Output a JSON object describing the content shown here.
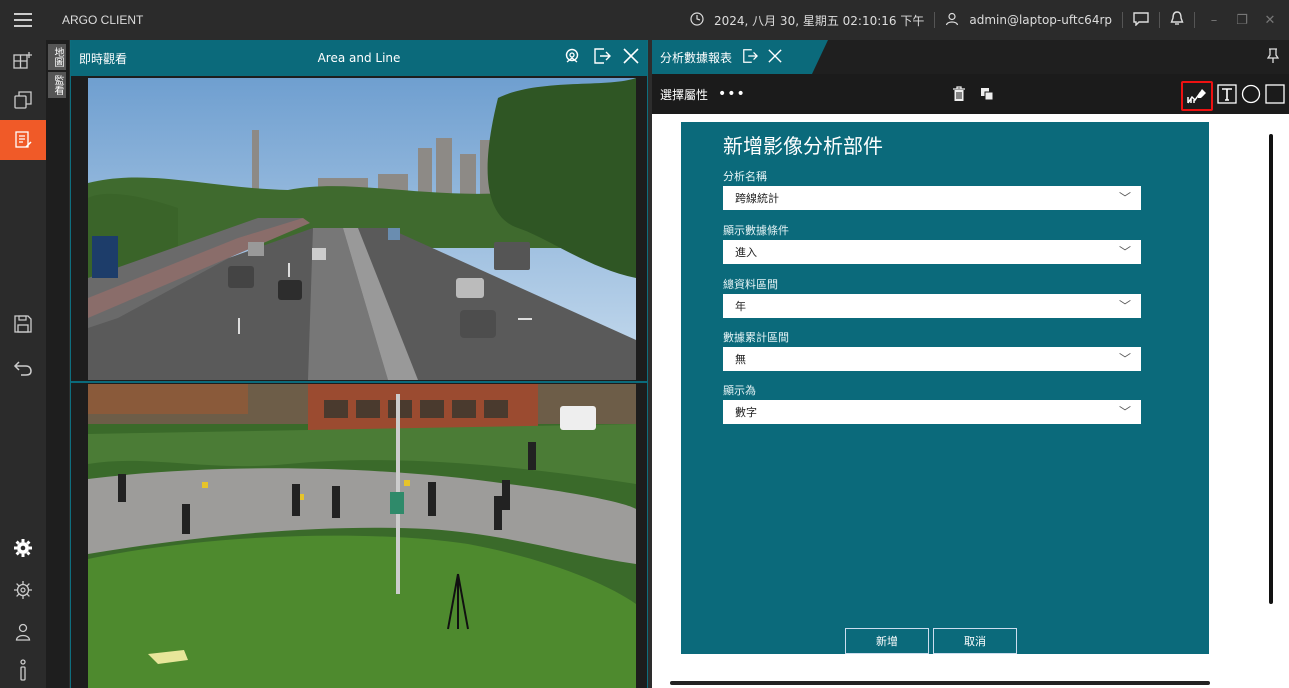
{
  "app": {
    "title": "ARGO CLIENT"
  },
  "titlebar": {
    "datetime": "2024, 八月 30, 星期五 02:10:16 下午",
    "user": "admin@laptop-uftc64rp"
  },
  "vertical_tabs": [
    "地圖",
    "監看"
  ],
  "video_panel": {
    "title": "即時觀看",
    "center_label": "Area and Line"
  },
  "report_panel": {
    "tab_title": "分析數據報表",
    "toolbar_label": "選擇屬性",
    "more": "•••"
  },
  "form": {
    "title": "新增影像分析部件",
    "fields": [
      {
        "label": "分析名稱",
        "value": "跨線統計"
      },
      {
        "label": "顯示數據條件",
        "value": "進入"
      },
      {
        "label": "總資料區間",
        "value": "年"
      },
      {
        "label": "數據累計區間",
        "value": "無"
      },
      {
        "label": "顯示為",
        "value": "數字"
      }
    ],
    "add_label": "新增",
    "cancel_label": "取消"
  },
  "colors": {
    "teal": "#0b6a7b",
    "accent": "#f05a28",
    "highlight": "#e11111"
  }
}
